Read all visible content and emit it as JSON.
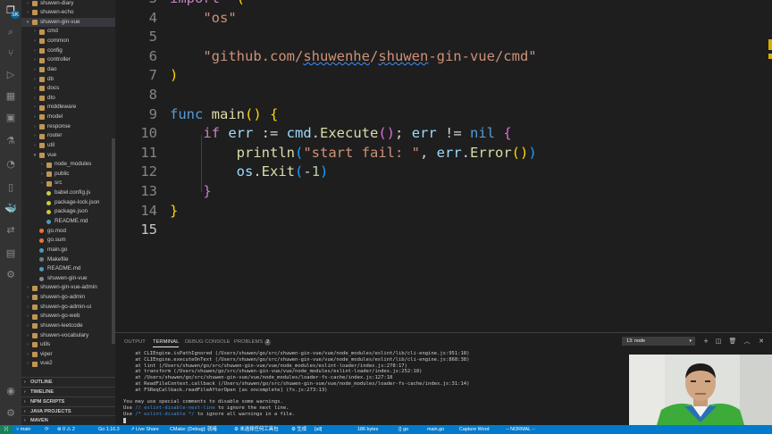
{
  "activity_bar": {
    "scm_badge": "5K",
    "icons": [
      "files-icon",
      "search-icon",
      "source-control-icon",
      "run-debug-icon",
      "extensions-icon",
      "remote-explorer-icon",
      "testing-icon",
      "git-graph-icon",
      "bookmarks-icon",
      "docker-icon",
      "live-share-icon",
      "project-manager-icon",
      "leetcode-icon",
      "account-icon",
      "settings-gear-icon"
    ]
  },
  "explorer": {
    "items": [
      {
        "label": "shuwen-diary",
        "indent": 1,
        "kind": "folder",
        "expanded": false
      },
      {
        "label": "shuwen-echo",
        "indent": 1,
        "kind": "folder",
        "expanded": false
      },
      {
        "label": "shuwen-gin-vue",
        "indent": 1,
        "kind": "folder",
        "expanded": true,
        "selected": true
      },
      {
        "label": "cmd",
        "indent": 2,
        "kind": "folder",
        "expanded": false
      },
      {
        "label": "common",
        "indent": 2,
        "kind": "folder",
        "expanded": false
      },
      {
        "label": "config",
        "indent": 2,
        "kind": "folder",
        "expanded": false
      },
      {
        "label": "controller",
        "indent": 2,
        "kind": "folder",
        "expanded": false
      },
      {
        "label": "dao",
        "indent": 2,
        "kind": "folder",
        "expanded": false
      },
      {
        "label": "db",
        "indent": 2,
        "kind": "folder",
        "expanded": false
      },
      {
        "label": "docs",
        "indent": 2,
        "kind": "folder",
        "expanded": false
      },
      {
        "label": "dto",
        "indent": 2,
        "kind": "folder",
        "expanded": false
      },
      {
        "label": "middleware",
        "indent": 2,
        "kind": "folder",
        "expanded": false
      },
      {
        "label": "model",
        "indent": 2,
        "kind": "folder",
        "expanded": false
      },
      {
        "label": "response",
        "indent": 2,
        "kind": "folder",
        "expanded": false
      },
      {
        "label": "router",
        "indent": 2,
        "kind": "folder",
        "expanded": false
      },
      {
        "label": "util",
        "indent": 2,
        "kind": "folder",
        "expanded": false
      },
      {
        "label": "vue",
        "indent": 2,
        "kind": "folder",
        "expanded": true
      },
      {
        "label": "node_modules",
        "indent": 3,
        "kind": "folder",
        "expanded": false
      },
      {
        "label": "public",
        "indent": 3,
        "kind": "folder",
        "expanded": false
      },
      {
        "label": "src",
        "indent": 3,
        "kind": "folder",
        "expanded": false
      },
      {
        "label": "babel.config.js",
        "indent": 3,
        "kind": "js"
      },
      {
        "label": "package-lock.json",
        "indent": 3,
        "kind": "json"
      },
      {
        "label": "package.json",
        "indent": 3,
        "kind": "json"
      },
      {
        "label": "README.md",
        "indent": 3,
        "kind": "md"
      },
      {
        "label": "go.mod",
        "indent": 2,
        "kind": "gomod"
      },
      {
        "label": "go.sum",
        "indent": 2,
        "kind": "gomod"
      },
      {
        "label": "main.go",
        "indent": 2,
        "kind": "go"
      },
      {
        "label": "Makefile",
        "indent": 2,
        "kind": "make"
      },
      {
        "label": "README.md",
        "indent": 2,
        "kind": "md"
      },
      {
        "label": "shuwen-gin-vue",
        "indent": 2,
        "kind": "file"
      },
      {
        "label": "shuwen-gin-vue-admin",
        "indent": 1,
        "kind": "folder",
        "expanded": false
      },
      {
        "label": "shuwen-go-admin",
        "indent": 1,
        "kind": "folder",
        "expanded": false
      },
      {
        "label": "shuwen-go-admin-ui",
        "indent": 1,
        "kind": "folder",
        "expanded": false
      },
      {
        "label": "shuwen-go-web",
        "indent": 1,
        "kind": "folder",
        "expanded": false,
        "hover": true
      },
      {
        "label": "shuwen-leetcode",
        "indent": 1,
        "kind": "folder",
        "expanded": false
      },
      {
        "label": "shuwen-vocabulary",
        "indent": 1,
        "kind": "folder",
        "expanded": false
      },
      {
        "label": "utils",
        "indent": 1,
        "kind": "folder",
        "expanded": false
      },
      {
        "label": "viper",
        "indent": 1,
        "kind": "folder",
        "expanded": false
      },
      {
        "label": "vue2",
        "indent": 1,
        "kind": "folder",
        "expanded": false
      }
    ],
    "sections": [
      "OUTLINE",
      "TIMELINE",
      "NPM SCRIPTS",
      "JAVA PROJECTS",
      "MAVEN"
    ]
  },
  "editor": {
    "lines": [
      {
        "n": "3",
        "tokens": [
          [
            "kw2",
            "import"
          ],
          [
            "",
            "  "
          ],
          [
            "br1",
            "("
          ]
        ]
      },
      {
        "n": "4",
        "tokens": [
          [
            "",
            "    "
          ],
          [
            "str",
            "\"os\""
          ]
        ]
      },
      {
        "n": "5",
        "tokens": []
      },
      {
        "n": "6",
        "tokens": [
          [
            "",
            "    "
          ],
          [
            "str",
            "\"github.com/"
          ],
          [
            "str sq",
            "shuwenhe"
          ],
          [
            "str",
            "/"
          ],
          [
            "str sq",
            "shuwen"
          ],
          [
            "str",
            "-gin-vue/cmd\""
          ]
        ]
      },
      {
        "n": "7",
        "tokens": [
          [
            "br1",
            ")"
          ]
        ]
      },
      {
        "n": "8",
        "tokens": []
      },
      {
        "n": "9",
        "tokens": [
          [
            "kw",
            "func"
          ],
          [
            "",
            " "
          ],
          [
            "fn",
            "main"
          ],
          [
            "br1",
            "()"
          ],
          [
            "",
            " "
          ],
          [
            "br1",
            "{"
          ]
        ]
      },
      {
        "n": "10",
        "tokens": [
          [
            "",
            "    "
          ],
          [
            "kw2",
            "if"
          ],
          [
            "",
            " "
          ],
          [
            "var",
            "err"
          ],
          [
            "",
            " := "
          ],
          [
            "var",
            "cmd"
          ],
          [
            "",
            "."
          ],
          [
            "fn",
            "Execute"
          ],
          [
            "br2",
            "()"
          ],
          [
            "",
            "; "
          ],
          [
            "var",
            "err"
          ],
          [
            "",
            " != "
          ],
          [
            "kw",
            "nil"
          ],
          [
            "",
            " "
          ],
          [
            "br2",
            "{"
          ]
        ]
      },
      {
        "n": "11",
        "tokens": [
          [
            "",
            "        "
          ],
          [
            "fn",
            "println"
          ],
          [
            "br3",
            "("
          ],
          [
            "str",
            "\"start fail: \""
          ],
          [
            "",
            ", "
          ],
          [
            "var",
            "err"
          ],
          [
            "",
            "."
          ],
          [
            "fn",
            "Error"
          ],
          [
            "br1",
            "()"
          ],
          [
            "br3",
            ")"
          ]
        ]
      },
      {
        "n": "12",
        "tokens": [
          [
            "",
            "        "
          ],
          [
            "var",
            "os"
          ],
          [
            "",
            "."
          ],
          [
            "fn",
            "Exit"
          ],
          [
            "br3",
            "("
          ],
          [
            "",
            "-"
          ],
          [
            "num",
            "1"
          ],
          [
            "br3",
            ")"
          ]
        ]
      },
      {
        "n": "13",
        "tokens": [
          [
            "",
            "    "
          ],
          [
            "br2",
            "}"
          ]
        ]
      },
      {
        "n": "14",
        "tokens": [
          [
            "br1",
            "}"
          ]
        ]
      },
      {
        "n": "15",
        "tokens": [],
        "current": true
      }
    ]
  },
  "panel": {
    "tabs": [
      {
        "label": "OUTPUT",
        "active": false
      },
      {
        "label": "TERMINAL",
        "active": true
      },
      {
        "label": "DEBUG CONSOLE",
        "active": false
      },
      {
        "label": "PROBLEMS",
        "active": false,
        "badge": "2"
      }
    ],
    "terminal_select": "13: node",
    "lines": [
      "    at CLIEngine.isPathIgnored (/Users/shuwen/go/src/shuwen-gin-vue/vue/node_modules/eslint/lib/cli-engine.js:951:18)",
      "    at CLIEngine.executeOnText (/Users/shuwen/go/src/shuwen-gin-vue/vue/node_modules/eslint/lib/cli-engine.js:868:38)",
      "    at lint (/Users/shuwen/go/src/shuwen-gin-vue/vue/node_modules/eslint-loader/index.js:278:17)",
      "    at transform (/Users/shuwen/go/src/shuwen-gin-vue/vue/node_modules/eslint-loader/index.js:252:18)",
      "    at /Users/shuwen/go/src/shuwen-gin-vue/vue/node_modules/loader-fs-cache/index.js:127:18",
      "    at ReadFileContext.callback (/Users/shuwen/go/src/shuwen-gin-vue/vue/node_modules/loader-fs-cache/index.js:31:14)",
      "    at FSReqCallback.readFileAfterOpen [as oncomplete] (fs.js:273:13)",
      "",
      "You may use special comments to disable some warnings."
    ],
    "line_use1_pre": "Use ",
    "line_use1_hl": "// eslint-disable-next-line",
    "line_use1_post": " to ignore the next line.",
    "line_use2_pre": "Use ",
    "line_use2_hl": "/* eslint-disable */",
    "line_use2_post": " to ignore all warnings in a file."
  },
  "statusbar": {
    "branch": "main",
    "sync": "⟳",
    "problems": "⊗ 0 ⚠ 2",
    "go_version": "Go 1.16.3",
    "live_share": "Live Share",
    "cmake": "CMake: [Debug]: 就绪",
    "kit": "⚙ 未选择任何工具包",
    "build": "⚙ 生成",
    "all": "[all]",
    "bytes": "186 bytes",
    "lang": "{} go",
    "file": "main.go",
    "capture": "Capture Word",
    "vim_mode": "-- NORMAL --"
  }
}
